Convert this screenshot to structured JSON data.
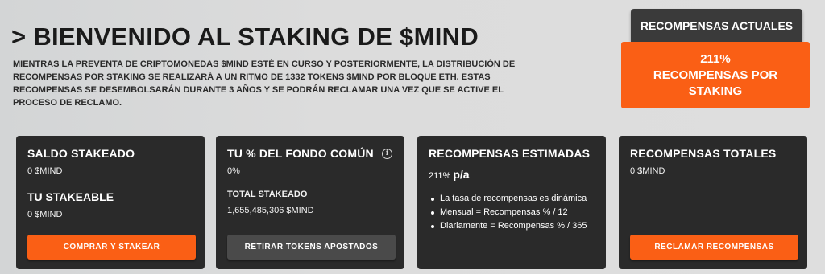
{
  "header": {
    "title": "> BIENVENIDO AL STAKING DE $MIND",
    "description": "MIENTRAS LA PREVENTA DE CRIPTOMONEDAS $MIND ESTÉ EN CURSO Y POSTERIORMENTE, LA DISTRIBUCIÓN DE RECOMPENSAS POR STAKING SE REALIZARÁ A UN RITMO DE 1332 TOKENS $MIND POR BLOQUE ETH. ESTAS RECOMPENSAS SE DESEMBOLSARÁN DURANTE 3 AÑOS Y SE PODRÁN RECLAMAR UNA VEZ QUE SE ACTIVE EL PROCESO DE RECLAMO."
  },
  "rewards": {
    "button_label": "RECOMPENSAS ACTUALES",
    "percent": "211%",
    "line1": "RECOMPENSAS POR",
    "line2": "STAKING"
  },
  "cards": {
    "staked": {
      "title": "SALDO STAKEADO",
      "value": "0 $MIND",
      "subtitle": "TU STAKEABLE",
      "subvalue": "0 $MIND",
      "button_label": "COMPRAR Y STAKEAR"
    },
    "pool": {
      "title": "TU % DEL FONDO COMÚN",
      "value": "0%",
      "total_label": "TOTAL STAKEADO",
      "total_value": "1,655,485,306 $MIND",
      "button_label": "RETIRAR TOKENS APOSTADOS",
      "info_icon": "i"
    },
    "estimated": {
      "title": "RECOMPENSAS ESTIMADAS",
      "rate": "211%",
      "rate_unit": "p/a",
      "bullets": [
        "La tasa de recompensas es dinámica",
        "Mensual = Recompensas % / 12",
        "Diariamente = Recompensas % / 365"
      ]
    },
    "total": {
      "title": "RECOMPENSAS TOTALES",
      "value": "0 $MIND",
      "button_label": "RECLAMAR RECOMPENSAS"
    }
  },
  "colors": {
    "accent": "#fa5f15",
    "card_bg": "#2a2a2a",
    "page_bg": "#dcdcdc"
  }
}
